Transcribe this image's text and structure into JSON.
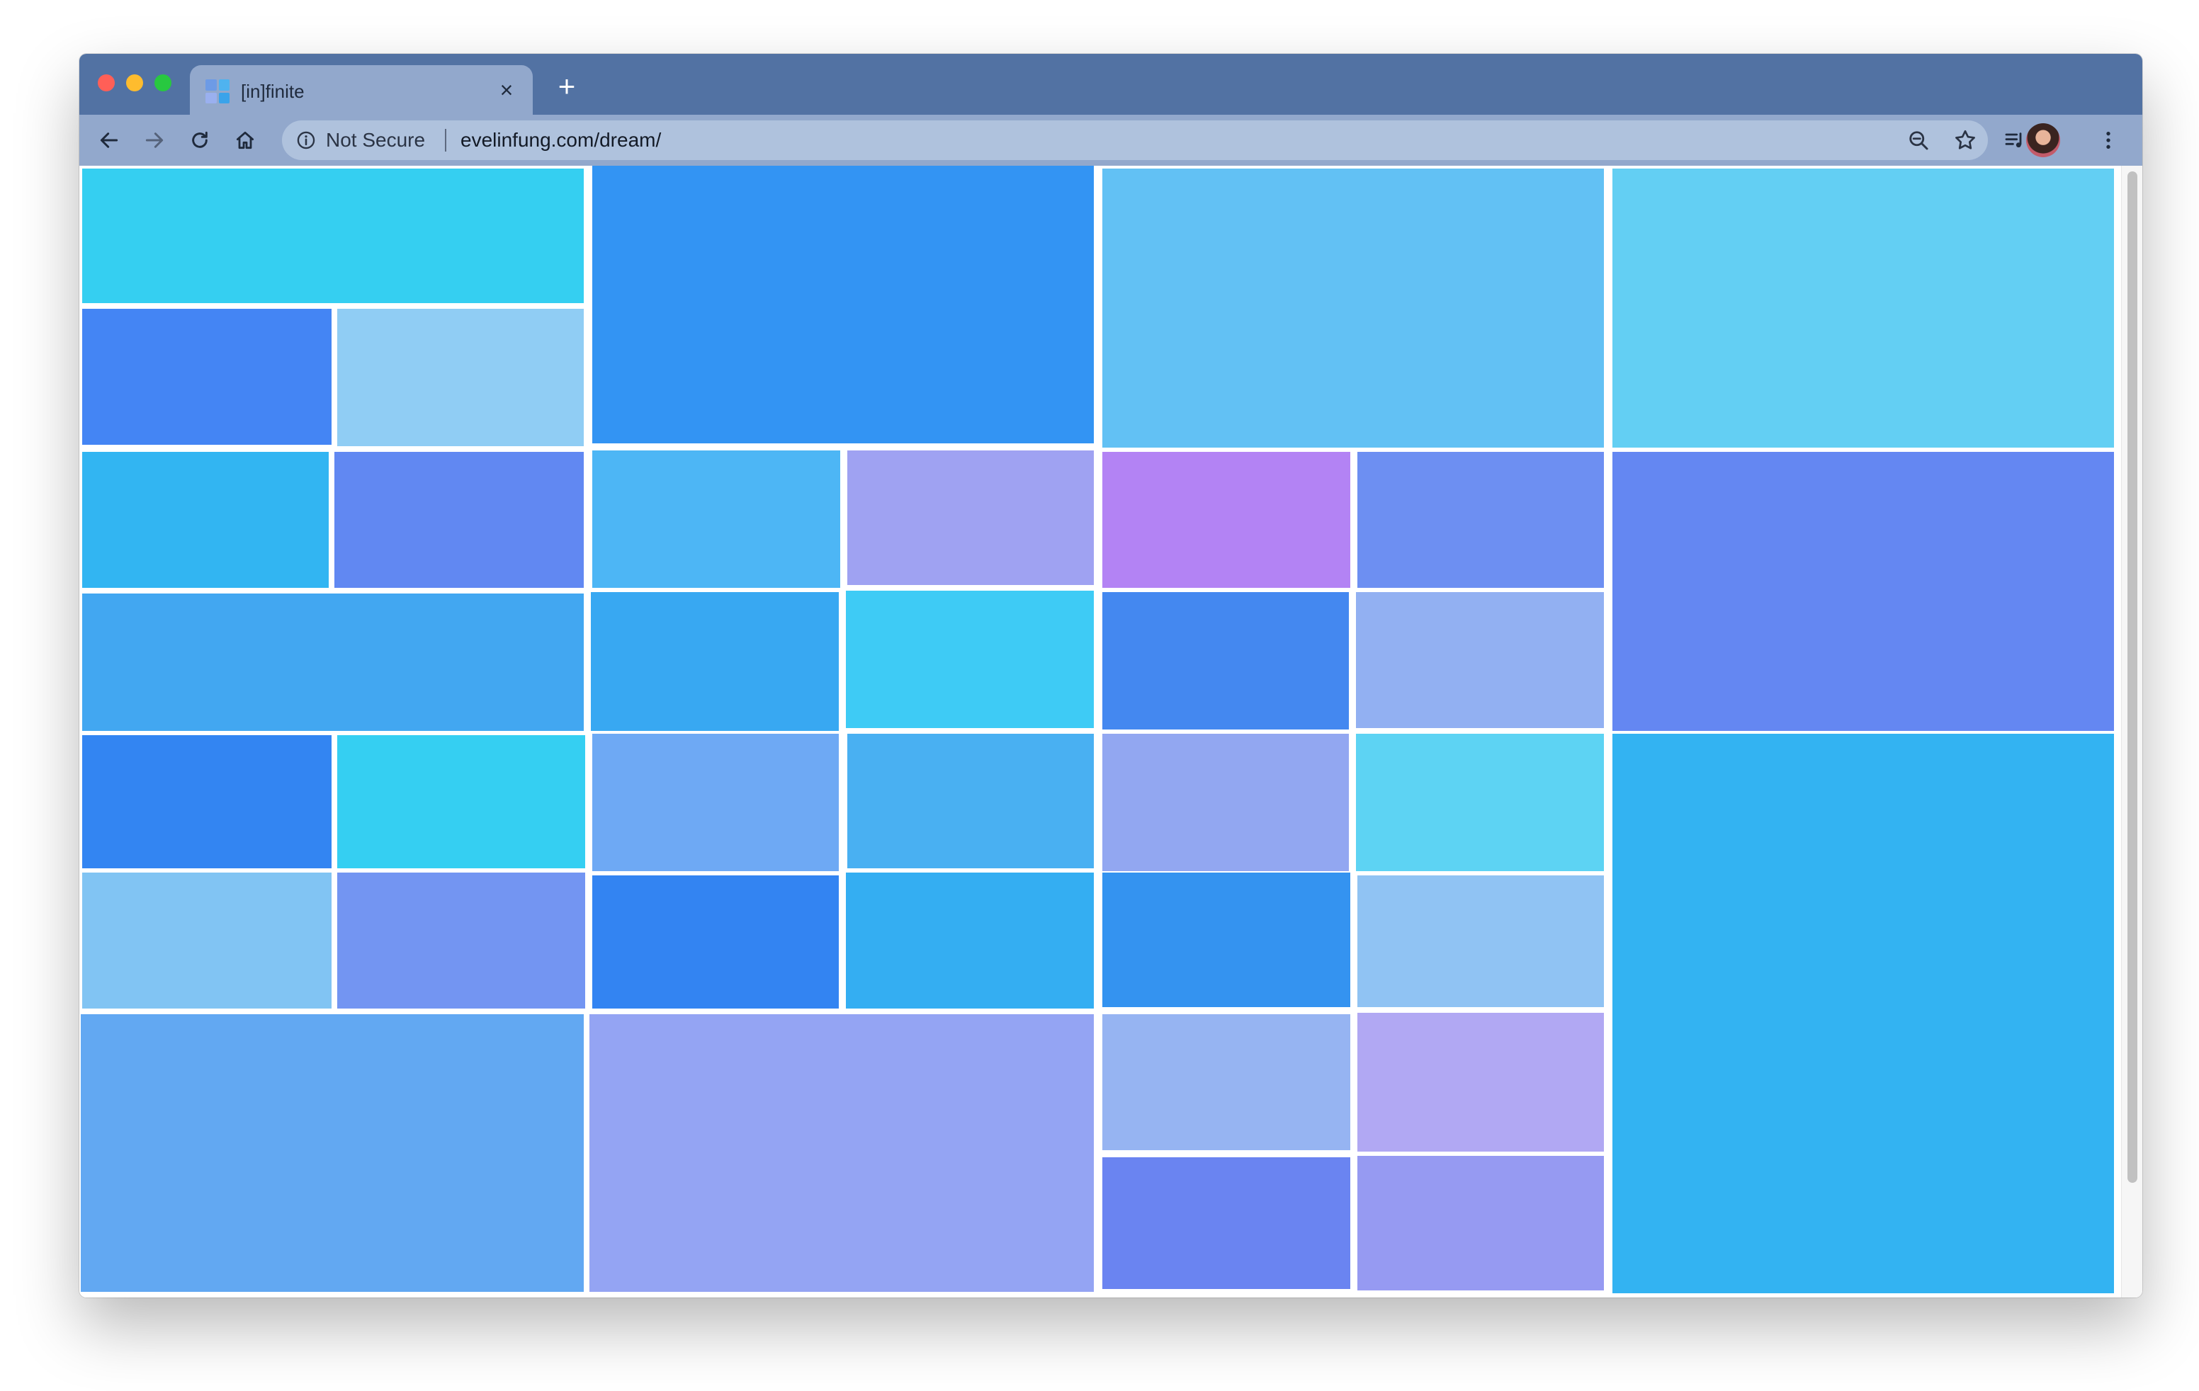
{
  "window": {
    "traffic_lights": {
      "close": "#ff5f57",
      "minimize": "#febc2e",
      "zoom": "#28c840"
    },
    "tabbar_color": "#5272a3",
    "toolbar_color": "#92a8cc"
  },
  "tab": {
    "title": "[in]finite",
    "close_glyph": "×",
    "favicon_colors": [
      "#6d9be6",
      "#4fb3ef",
      "#9ab0ef",
      "#3aa3ea"
    ]
  },
  "new_tab_glyph": "+",
  "toolbar": {
    "back_icon": "arrow-left-icon",
    "forward_icon": "arrow-right-icon",
    "reload_icon": "reload-icon",
    "home_icon": "home-icon",
    "security_label": "Not Secure",
    "url": "evelinfung.com/dream/",
    "zoom_icon": "zoom-out-icon",
    "bookmark_icon": "star-icon",
    "media_icon": "media-queue-icon",
    "menu_icon": "more-vertical-icon"
  },
  "mosaic": {
    "tiles": [
      {
        "color": "#35cff1"
      },
      {
        "color": "#3394f3"
      },
      {
        "color": "#62c1f4"
      },
      {
        "color": "#63cff3"
      },
      {
        "color": "#4485f4"
      },
      {
        "color": "#90cdf4"
      },
      {
        "color": "#32b5f2"
      },
      {
        "color": "#6188f2"
      },
      {
        "color": "#4db6f5"
      },
      {
        "color": "#9fa2f2"
      },
      {
        "color": "#b383f4"
      },
      {
        "color": "#6d8ff2"
      },
      {
        "color": "#6487f2"
      },
      {
        "color": "#42a7f1"
      },
      {
        "color": "#38a8f2"
      },
      {
        "color": "#3ecbf5"
      },
      {
        "color": "#4488f0"
      },
      {
        "color": "#92b0f2"
      },
      {
        "color": "#3385f2"
      },
      {
        "color": "#35cff2"
      },
      {
        "color": "#6ea9f4"
      },
      {
        "color": "#49b0f2"
      },
      {
        "color": "#92a7f1"
      },
      {
        "color": "#5dd3f3"
      },
      {
        "color": "#33b3f2"
      },
      {
        "color": "#81c4f3"
      },
      {
        "color": "#7395f2"
      },
      {
        "color": "#3384f2"
      },
      {
        "color": "#34aef2"
      },
      {
        "color": "#3493f0"
      },
      {
        "color": "#90c3f3"
      },
      {
        "color": "#62a8f2"
      },
      {
        "color": "#94a4f3"
      },
      {
        "color": "#96b4f2"
      },
      {
        "color": "#b1a8f3"
      },
      {
        "color": "#6a84f1"
      },
      {
        "color": "#969af2"
      }
    ]
  }
}
